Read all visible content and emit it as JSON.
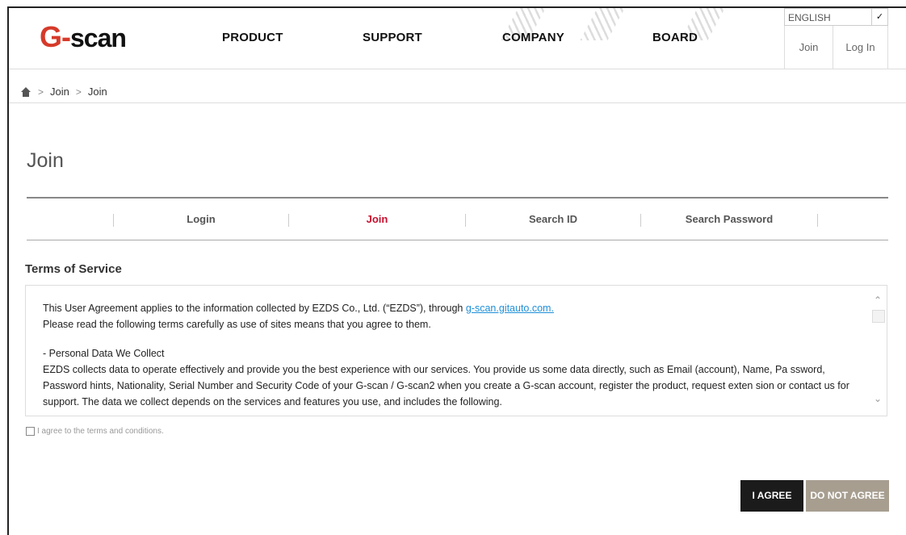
{
  "header": {
    "logo": {
      "accent": "G-",
      "rest": "scan"
    },
    "nav": [
      "PRODUCT",
      "SUPPORT",
      "COMPANY",
      "BOARD"
    ],
    "language": "ENGLISH",
    "join_label": "Join",
    "login_label": "Log In"
  },
  "breadcrumb": [
    "Join",
    "Join"
  ],
  "page_title": "Join",
  "tabs": [
    {
      "label": "Login",
      "active": false
    },
    {
      "label": "Join",
      "active": true
    },
    {
      "label": "Search ID",
      "active": false
    },
    {
      "label": "Search Password",
      "active": false
    }
  ],
  "terms": {
    "section_title": "Terms of Service",
    "line1_before_link": "This User Agreement applies to the information collected by EZDS Co., Ltd. (“EZDS”), through ",
    "link_text": "g-scan.gitauto.com.",
    "line2": "Please read the following terms carefully as use of sites means that you agree to them.",
    "heading": "- Personal Data We Collect",
    "body": "EZDS collects data to operate effectively and provide you the best experience with our services. You provide us some data directly, such as Email (account), Name, Pa ssword, Password hints, Nationality, Serial Number and Security Code of your G-scan / G-scan2 when you create a G-scan account, register the product, request exten sion or contact us for support. The data we collect depends on the services and features you use, and includes the following."
  },
  "agree_checkbox_label": "I agree to the terms and conditions.",
  "buttons": {
    "agree": "I AGREE",
    "disagree": "DO NOT AGREE"
  },
  "colors": {
    "active_tab": "#c8102e",
    "logo_accent": "#d63a2a",
    "agree_bg": "#1b1b1b",
    "disagree_bg": "#a79e90",
    "link": "#1e8fd8"
  }
}
